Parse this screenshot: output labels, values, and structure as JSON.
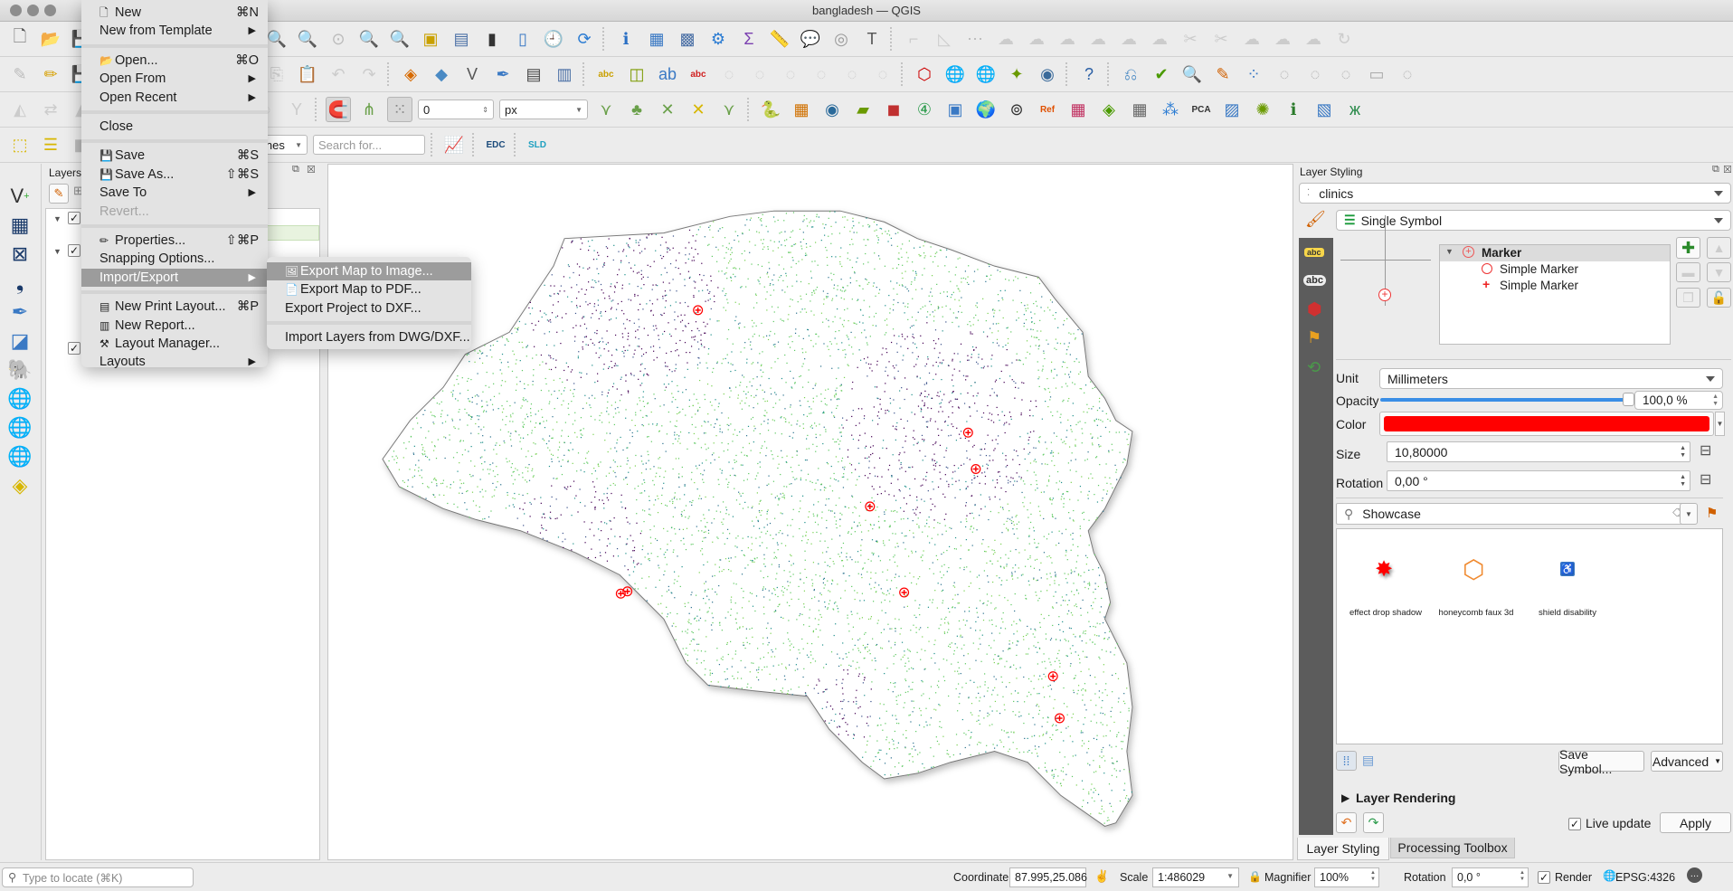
{
  "window": {
    "title": "bangladesh — QGIS"
  },
  "toolbars": {
    "row1": [
      {
        "name": "new-project-icon",
        "g": "🗋",
        "c": "#555"
      },
      {
        "name": "open-project-icon",
        "g": "📂",
        "c": "#e5b000"
      },
      {
        "name": "save-project-icon",
        "g": "💾",
        "c": "#4a6fa5"
      },
      {
        "sep": true
      },
      {
        "name": "pan-icon",
        "g": "✋",
        "c": "#c9a000"
      },
      {
        "name": "pan-to-selection-icon",
        "g": "✥",
        "c": "#3a79c4"
      },
      {
        "name": "zoom-in-icon",
        "g": "🔍",
        "c": "#333"
      },
      {
        "name": "zoom-out-icon",
        "g": "🔎",
        "c": "#333"
      },
      {
        "name": "zoom-full-icon",
        "g": "⤢",
        "c": "#3a79c4"
      },
      {
        "name": "zoom-to-selection-icon",
        "g": "🔍",
        "c": "#d7b600"
      },
      {
        "name": "zoom-to-layer-icon",
        "g": "🔍",
        "c": "#666"
      },
      {
        "name": "zoom-native-icon",
        "g": "⊙",
        "c": "#bbb"
      },
      {
        "name": "zoom-last-icon",
        "g": "🔍",
        "c": "#3a79c4"
      },
      {
        "name": "zoom-next-icon",
        "g": "🔍",
        "c": "#bbb"
      },
      {
        "name": "new-map-view-icon",
        "g": "▣",
        "c": "#c9a000"
      },
      {
        "name": "new-3d-view-icon",
        "g": "▤",
        "c": "#4a6fa5"
      },
      {
        "name": "bookmark-icon",
        "g": "▮",
        "c": "#333"
      },
      {
        "name": "show-bookmarks-icon",
        "g": "▯",
        "c": "#3a79c4"
      },
      {
        "name": "temporal-controller-icon",
        "g": "🕘",
        "c": "#555"
      },
      {
        "name": "refresh-icon",
        "g": "⟳",
        "c": "#2a7bd2"
      },
      {
        "sep": true
      },
      {
        "name": "identify-icon",
        "g": "ℹ",
        "c": "#2a6fc4"
      },
      {
        "name": "attribute-table-icon",
        "g": "▦",
        "c": "#3a79c4"
      },
      {
        "name": "field-calculator-icon",
        "g": "▩",
        "c": "#4a6fa5"
      },
      {
        "name": "processing-toolbox-icon",
        "g": "⚙",
        "c": "#2a7bd2"
      },
      {
        "name": "statistics-icon",
        "g": "Σ",
        "c": "#7a3fb0"
      },
      {
        "name": "measure-icon",
        "g": "📏",
        "c": "#555"
      },
      {
        "name": "map-tips-icon",
        "g": "💬",
        "c": "#e8c800"
      },
      {
        "name": "select-by-location-icon",
        "g": "◎",
        "c": "#999"
      },
      {
        "name": "text-annotation-icon",
        "g": "T",
        "c": "#555"
      },
      {
        "sep": true
      },
      {
        "name": "digitize-1-icon",
        "g": "⌐",
        "c": "#ccc"
      },
      {
        "name": "digitize-2-icon",
        "g": "◺",
        "c": "#ccc"
      },
      {
        "name": "digitize-3-icon",
        "g": "⋯",
        "c": "#bbb"
      },
      {
        "name": "digitize-4-icon",
        "g": "☁",
        "c": "#ccc"
      },
      {
        "name": "digitize-5-icon",
        "g": "☁",
        "c": "#ccc"
      },
      {
        "name": "digitize-6-icon",
        "g": "☁",
        "c": "#ccc"
      },
      {
        "name": "digitize-7-icon",
        "g": "☁",
        "c": "#ccc"
      },
      {
        "name": "digitize-8-icon",
        "g": "☁",
        "c": "#ccc"
      },
      {
        "name": "digitize-9-icon",
        "g": "☁",
        "c": "#ccc"
      },
      {
        "name": "digitize-10-icon",
        "g": "✂",
        "c": "#ccc"
      },
      {
        "name": "digitize-11-icon",
        "g": "✂",
        "c": "#ccc"
      },
      {
        "name": "digitize-12-icon",
        "g": "☁",
        "c": "#ccc"
      },
      {
        "name": "digitize-13-icon",
        "g": "☁",
        "c": "#ccc"
      },
      {
        "name": "digitize-14-icon",
        "g": "☁",
        "c": "#ccc"
      },
      {
        "name": "digitize-15-icon",
        "g": "↻",
        "c": "#ccc"
      }
    ],
    "row2": [
      {
        "name": "toggle-editing-icon",
        "g": "✎",
        "c": "#bbb"
      },
      {
        "name": "current-edits-icon",
        "g": "✏",
        "c": "#d7a000"
      },
      {
        "name": "save-edits-icon",
        "g": "💾",
        "c": "#bbb"
      },
      {
        "sep": true
      },
      {
        "name": "add-feature-icon",
        "g": "◇",
        "c": "#ccc"
      },
      {
        "name": "move-feature-icon",
        "g": "✥",
        "c": "#ccc"
      },
      {
        "name": "node-tool-icon",
        "g": "⋄",
        "c": "#ccc"
      },
      {
        "name": "delete-icon",
        "g": "🗑",
        "c": "#ccc"
      },
      {
        "name": "cut-icon",
        "g": "✂",
        "c": "#ccc"
      },
      {
        "name": "copy-icon",
        "g": "⎘",
        "c": "#ccc"
      },
      {
        "name": "paste-icon",
        "g": "📋",
        "c": "#ccc"
      },
      {
        "name": "undo-icon",
        "g": "↶",
        "c": "#ccc"
      },
      {
        "name": "redo-icon",
        "g": "↷",
        "c": "#ccc"
      },
      {
        "sep": true
      },
      {
        "name": "new-geopackage-icon",
        "g": "◈",
        "c": "#d76a00"
      },
      {
        "name": "new-spatialite-icon",
        "g": "◆",
        "c": "#4a8ac4"
      },
      {
        "name": "new-virtual-layer-icon",
        "g": "V",
        "c": "#555"
      },
      {
        "name": "new-temp-layer-icon",
        "g": "✒",
        "c": "#3a79c4"
      },
      {
        "name": "gps-icon",
        "g": "▤",
        "c": "#444"
      },
      {
        "name": "new-shapefile-icon",
        "g": "▥",
        "c": "#4a6fa5"
      },
      {
        "sep": true
      },
      {
        "name": "label-tool-icon",
        "g": "abc",
        "c": "#c9a000"
      },
      {
        "name": "label-pin-icon",
        "g": "◫",
        "c": "#7b9a00"
      },
      {
        "name": "label-show-icon",
        "g": "ab",
        "c": "#3a79c4"
      },
      {
        "name": "label-highlight-icon",
        "g": "abc",
        "c": "#d02020"
      },
      {
        "name": "label-move-icon",
        "g": "◌",
        "c": "#ccc"
      },
      {
        "name": "label-rotate-icon",
        "g": "◌",
        "c": "#ccc"
      },
      {
        "name": "label-change-icon",
        "g": "◌",
        "c": "#ccc"
      },
      {
        "name": "label-props-icon",
        "g": "◌",
        "c": "#ccc"
      },
      {
        "name": "label-8-icon",
        "g": "◌",
        "c": "#ccc"
      },
      {
        "name": "label-9-icon",
        "g": "◌",
        "c": "#ccc"
      },
      {
        "sep": true
      },
      {
        "name": "georef-icon",
        "g": "⬡",
        "c": "#c00"
      },
      {
        "name": "raster-calc-icon",
        "g": "🌐",
        "c": "#3a79c4"
      },
      {
        "name": "raster-align-icon",
        "g": "🌐",
        "c": "#3a79c4"
      },
      {
        "name": "plugin-icon",
        "g": "✦",
        "c": "#6a9a00"
      },
      {
        "name": "sketch-icon",
        "g": "◉",
        "c": "#3a6a9a"
      },
      {
        "sep": true
      },
      {
        "name": "help-icon",
        "g": "?",
        "c": "#2a5fa5"
      },
      {
        "sep": true
      },
      {
        "name": "network-icon",
        "g": "⎌",
        "c": "#4a8ac4"
      },
      {
        "name": "check-icon",
        "g": "✔",
        "c": "#4a9a00"
      },
      {
        "name": "locator-icon",
        "g": "🔍",
        "c": "#3aa04a"
      },
      {
        "name": "style-icon",
        "g": "✎",
        "c": "#d06000"
      },
      {
        "name": "points-icon",
        "g": "⁘",
        "c": "#3a79c4"
      },
      {
        "name": "shape-1-icon",
        "g": "◌",
        "c": "#aaa"
      },
      {
        "name": "shape-2-icon",
        "g": "◌",
        "c": "#aaa"
      },
      {
        "name": "shape-3-icon",
        "g": "◌",
        "c": "#aaa"
      },
      {
        "name": "shape-4-icon",
        "g": "▭",
        "c": "#aaa"
      },
      {
        "name": "shape-5-icon",
        "g": "◌",
        "c": "#aaa"
      }
    ],
    "row3": [
      {
        "name": "advanced-digitize-1-icon",
        "g": "◭",
        "c": "#ccc"
      },
      {
        "name": "advanced-digitize-2-icon",
        "g": "⇄",
        "c": "#ccc"
      },
      {
        "name": "advanced-digitize-3-icon",
        "g": "◭",
        "c": "#ccc"
      },
      {
        "name": "advanced-digitize-4-icon",
        "g": "◌",
        "c": "#ccc"
      },
      {
        "name": "advanced-digitize-5-icon",
        "g": "◌",
        "c": "#ccc"
      },
      {
        "name": "advanced-digitize-6-icon",
        "g": "◌",
        "c": "#ccc"
      },
      {
        "name": "advanced-digitize-7-icon",
        "g": "◌",
        "c": "#ccc"
      },
      {
        "name": "advanced-digitize-8-icon",
        "g": "◌",
        "c": "#ccc"
      },
      {
        "name": "advanced-digitize-9-icon",
        "g": "◌",
        "c": "#ccc"
      },
      {
        "name": "advanced-digitize-10-icon",
        "g": "Y",
        "c": "#ccc"
      },
      {
        "sep": true
      },
      {
        "name": "snapping-magnet-icon",
        "g": "🧲",
        "c": "#d00",
        "pressed": true
      },
      {
        "name": "snapping-vertex-icon",
        "g": "⋔",
        "c": "#6aa04a"
      },
      {
        "name": "snapping-type-icon",
        "g": "⁙",
        "c": "#888",
        "pressed": true
      },
      {
        "input": "snapping-tolerance-field",
        "bind": "snapping.tolerance",
        "w": 84
      },
      {
        "input": "snapping-units-combo",
        "bind": "snapping.units",
        "w": 98,
        "caret": true
      },
      {
        "name": "trace-icon",
        "g": "⋎",
        "c": "#6aa04a"
      },
      {
        "name": "topology-icon",
        "g": "♣",
        "c": "#6aa04a"
      },
      {
        "name": "intersection-icon",
        "g": "✕",
        "c": "#6aa04a"
      },
      {
        "name": "self-snap-icon",
        "g": "✕",
        "c": "#d7b600"
      },
      {
        "name": "snapping-more-icon",
        "g": "⋎",
        "c": "#6aa04a"
      },
      {
        "sep": true
      },
      {
        "name": "python-icon",
        "g": "🐍",
        "c": "#3a79c4"
      },
      {
        "name": "plugin-grid-icon",
        "g": "▦",
        "c": "#d07000"
      },
      {
        "name": "plugin-globe-icon",
        "g": "◉",
        "c": "#2a6a9a"
      },
      {
        "name": "plugin-folder-icon",
        "g": "▰",
        "c": "#6a9a00"
      },
      {
        "name": "plugin-red-icon",
        "g": "◼",
        "c": "#c03030"
      },
      {
        "name": "plugin-4-icon",
        "g": "④",
        "c": "#2a9a4a"
      },
      {
        "name": "plugin-frame-icon",
        "g": "▣",
        "c": "#3a79c4"
      },
      {
        "name": "plugin-earth-icon",
        "g": "🌍",
        "c": "#1a3a6a"
      },
      {
        "name": "plugin-binoculars-icon",
        "g": "⊚",
        "c": "#333"
      },
      {
        "name": "plugin-ref-icon",
        "g": "Ref",
        "c": "#e05000"
      },
      {
        "name": "plugin-grid2-icon",
        "g": "▦",
        "c": "#c03060"
      },
      {
        "name": "plugin-layers-icon",
        "g": "◈",
        "c": "#4a9a00"
      },
      {
        "name": "plugin-table-icon",
        "g": "▦",
        "c": "#666"
      },
      {
        "name": "plugin-network-icon",
        "g": "⁂",
        "c": "#2a7bd2"
      },
      {
        "name": "plugin-pca-icon",
        "g": "PCA",
        "c": "#333"
      },
      {
        "name": "plugin-chart-icon",
        "g": "▨",
        "c": "#3a79c4"
      },
      {
        "name": "plugin-gear-icon",
        "g": "✺",
        "c": "#6a9a00"
      },
      {
        "name": "plugin-info-icon",
        "g": "ℹ",
        "c": "#2a7a2a"
      },
      {
        "name": "plugin-map-icon",
        "g": "▧",
        "c": "#3a79c4"
      },
      {
        "name": "plugin-butterfly-icon",
        "g": "ж",
        "c": "#2a8a4a"
      }
    ],
    "row4": [
      {
        "name": "select-features-icon",
        "g": "⬚",
        "c": "#d7b600"
      },
      {
        "name": "select-attribute-icon",
        "g": "☰",
        "c": "#d7b600"
      },
      {
        "name": "deselect-icon",
        "g": "◧",
        "c": "#bbb"
      },
      {
        "name": "select-4-icon",
        "g": "◧",
        "c": "#bbb"
      },
      {
        "name": "select-5-icon",
        "g": "◧",
        "c": "#bbb"
      },
      {
        "name": "select-6-icon",
        "g": "◧",
        "c": "#bbb"
      },
      {
        "name": "geocoder-search-icon",
        "g": "🔍",
        "c": "#333"
      },
      {
        "input": "country-combo",
        "bind": "search.country",
        "w": 94,
        "caret": true
      },
      {
        "input": "search-input",
        "bind": "search.placeholder",
        "w": 124,
        "ph": true
      },
      {
        "sep": true
      },
      {
        "name": "profile-chart-icon",
        "g": "📈",
        "c": "#c030a0"
      },
      {
        "sep": true
      },
      {
        "name": "edc-icon",
        "g": "EDC",
        "c": "#1a4a7a"
      },
      {
        "sep": true
      },
      {
        "name": "sld-icon",
        "g": "SLD",
        "c": "#20a0c0"
      }
    ]
  },
  "snapping": {
    "tolerance": "0",
    "units": "px"
  },
  "search": {
    "country": "Philippines",
    "placeholder": "Search for..."
  },
  "file_menu": {
    "items": [
      {
        "label": "New",
        "shortcut": "⌘N",
        "icon": "new-file-icon",
        "g": "🗋"
      },
      {
        "label": "New from Template",
        "submenu": true
      },
      {
        "sep": true
      },
      {
        "label": "Open...",
        "shortcut": "⌘O",
        "icon": "folder-icon",
        "g": "📂"
      },
      {
        "label": "Open From",
        "submenu": true
      },
      {
        "label": "Open Recent",
        "submenu": true
      },
      {
        "sep": true
      },
      {
        "label": "Close"
      },
      {
        "sep": true
      },
      {
        "label": "Save",
        "shortcut": "⌘S",
        "icon": "save-icon",
        "g": "💾"
      },
      {
        "label": "Save As...",
        "shortcut": "⇧⌘S",
        "icon": "save-as-icon",
        "g": "💾"
      },
      {
        "label": "Save To",
        "submenu": true
      },
      {
        "label": "Revert...",
        "disabled": true
      },
      {
        "sep": true
      },
      {
        "label": "Properties...",
        "shortcut": "⇧⌘P",
        "icon": "properties-icon",
        "g": "✏"
      },
      {
        "label": "Snapping Options..."
      },
      {
        "label": "Import/Export",
        "submenu": true,
        "highlighted": true
      },
      {
        "sep": true
      },
      {
        "label": "New Print Layout...",
        "shortcut": "⌘P",
        "icon": "print-layout-icon",
        "g": "▤"
      },
      {
        "label": "New Report...",
        "icon": "report-icon",
        "g": "▥"
      },
      {
        "label": "Layout Manager...",
        "icon": "layout-manager-icon",
        "g": "⚒"
      },
      {
        "label": "Layouts",
        "submenu": true
      }
    ]
  },
  "import_export_menu": {
    "items": [
      {
        "label": "Export Map to Image...",
        "icon": "export-image-icon",
        "g": "🖼",
        "highlighted": true
      },
      {
        "label": "Export Map to PDF...",
        "icon": "export-pdf-icon",
        "g": "📄"
      },
      {
        "label": "Export Project to DXF..."
      },
      {
        "sep": true
      },
      {
        "label": "Import Layers from DWG/DXF..."
      }
    ]
  },
  "layers_panel": {
    "title": "Layers"
  },
  "map": {
    "clinic_color": "#ff0000",
    "point_palette": [
      "#440154",
      "#3b528b",
      "#21918c",
      "#5ec962",
      "#7ad151",
      "#2c728e"
    ]
  },
  "styling": {
    "title": "Layer Styling",
    "layer": "clinics",
    "renderer": "Single Symbol",
    "symbol_tree": {
      "root": "Marker",
      "children": [
        "Simple Marker",
        "Simple Marker"
      ]
    },
    "unit_label": "Unit",
    "unit": "Millimeters",
    "opacity_label": "Opacity",
    "opacity": "100,0 %",
    "opacity_fraction": 1.0,
    "color_label": "Color",
    "color": "#ff0000",
    "size_label": "Size",
    "size": "10,80000",
    "rotation_label": "Rotation",
    "rotation": "0,00 °",
    "library_search": "Showcase",
    "symbols": [
      {
        "label": "effect drop shadow",
        "icon": "red-star-icon"
      },
      {
        "label": "honeycomb faux 3d",
        "icon": "orange-hexagon-icon"
      },
      {
        "label": "shield disability",
        "icon": "wheelchair-icon"
      }
    ],
    "save_symbol": "Save Symbol...",
    "advanced": "Advanced",
    "layer_rendering": "Layer Rendering",
    "live_update": "Live update",
    "live_update_checked": true,
    "apply": "Apply"
  },
  "dock_tabs": [
    {
      "label": "Layer Styling",
      "active": true
    },
    {
      "label": "Processing Toolbox",
      "active": false
    }
  ],
  "statusbar": {
    "locate_placeholder": "Type to locate (⌘K)",
    "coordinate_label": "Coordinate",
    "coordinate": "87.995,25.086",
    "scale_label": "Scale",
    "scale": "1:486029",
    "magnifier_label": "Magnifier",
    "magnifier": "100%",
    "rotation_label": "Rotation",
    "rotation": "0,0 °",
    "render_label": "Render",
    "render_checked": true,
    "crs": "EPSG:4326"
  }
}
